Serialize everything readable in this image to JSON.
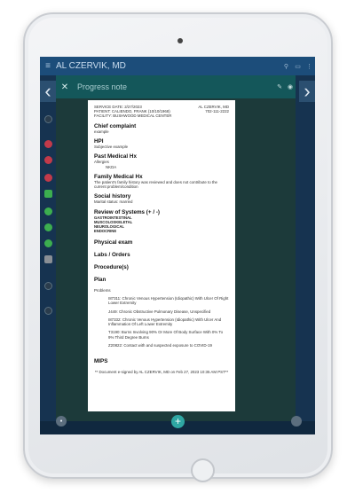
{
  "app": {
    "title": "AL CZERVIK, MD"
  },
  "dialog": {
    "title": "Progress note"
  },
  "document": {
    "service_date": "SERVICE DATE: 2/27/2023",
    "patient": "PATIENT: CALIENDO, FRANK (10/10/1968)",
    "facility": "FACILITY: BUSHWOOD MEDICAL CENTER",
    "provider_name": "AL CZERVIK, MD",
    "provider_phone": "702-111-2222",
    "sections": {
      "chief_complaint": {
        "title": "Chief complaint",
        "text": "example"
      },
      "hpi": {
        "title": "HPI",
        "text": "Subjective example"
      },
      "past_medical": {
        "title": "Past Medical Hx",
        "label": "Allergies",
        "value": "NKDA"
      },
      "family": {
        "title": "Family Medical Hx",
        "text": "The patient's family history was reviewed and does not contribute to the current problem/condition"
      },
      "social": {
        "title": "Social history",
        "text": "Marital status: married"
      },
      "ros": {
        "title": "Review of Systems (+ / -)",
        "items": [
          "GASTROINTESTINAL",
          "MUSCOLOSKELETAL",
          "NEUROLOGICAL",
          "ENDOCRINE"
        ]
      },
      "physical": {
        "title": "Physical exam"
      },
      "labs": {
        "title": "Labs / Orders"
      },
      "procedures": {
        "title": "Procedure(s)"
      },
      "plan": {
        "title": "Plan"
      },
      "problems": {
        "label": "Problems",
        "items": [
          "I87311: Chronic Venous Hypertension (Idiopathic) With Ulcer Of Right Lower Extremity",
          "J449: Chronic Obstructive Pulmonary Disease, Unspecified",
          "I87332: Chronic Venous Hypertension (Idiopathic) With Ulcer And Inflammation Of Left Lower Extremity",
          "T3190: Burns Involving 90% Or More Of Body Surface With 0% To 9% Third Degree Burns",
          "Z20822: Contact with and suspected exposure to COVID-19"
        ]
      },
      "mips": {
        "title": "MIPS"
      }
    },
    "signature": "** Document e-signed by AL CZERVIK, MD on Feb 27, 2023 10:35 AM PST**"
  },
  "colors": {
    "app_bar": "#1c4d7a",
    "screen_bg": "#173653",
    "dialog_header": "#14575a",
    "fab": "#2fa7a3"
  },
  "icons": [
    "menu-icon",
    "search-icon",
    "clipboard-icon",
    "more-icon",
    "close-icon",
    "edit-icon",
    "view-icon",
    "chevron-left-icon",
    "chevron-right-icon",
    "add-icon"
  ]
}
